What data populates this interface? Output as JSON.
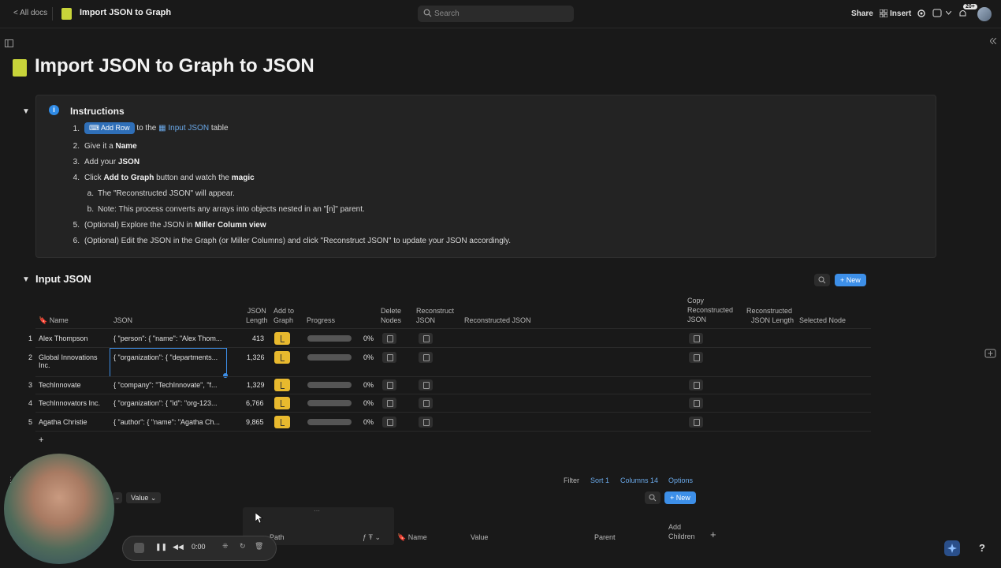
{
  "topbar": {
    "back": "< All docs",
    "title": "Import JSON to Graph",
    "search_placeholder": "Search",
    "share": "Share",
    "insert": "Insert",
    "notifications_badge": "20+"
  },
  "page": {
    "title": "Import JSON to Graph to JSON"
  },
  "instructions": {
    "title": "Instructions",
    "step1_button": "Add Row",
    "step1_mid": "to the",
    "step1_link": "Input JSON",
    "step1_end": "table",
    "step2_pre": "Give it a",
    "step2_bold": "Name",
    "step3_pre": "Add your",
    "step3_bold": "JSON",
    "step4_pre": "Click",
    "step4_bold": "Add to Graph",
    "step4_mid": "button and watch the",
    "step4_bold2": "magic",
    "step4a": "The \"Reconstructed JSON\" will appear.",
    "step4b": "Note: This process converts any arrays into objects nested in an \"[n]\" parent.",
    "step5_pre": "(Optional) Explore the JSON in",
    "step5_bold": "Miller Column view",
    "step6": "(Optional) Edit the JSON in the Graph (or Miller Columns) and click \"Reconstruct JSON\" to update your JSON accordingly.",
    "numbers": [
      "1.",
      "2.",
      "3.",
      "4.",
      "a.",
      "b.",
      "5.",
      "6."
    ]
  },
  "table": {
    "title": "Input JSON",
    "new_button": "New",
    "headers": {
      "name": "Name",
      "json": "JSON",
      "json_length_1": "JSON",
      "json_length_2": "Length",
      "add_graph_1": "Add to",
      "add_graph_2": "Graph",
      "progress": "Progress",
      "delete_1": "Delete",
      "delete_2": "Nodes",
      "reconstruct_1": "Reconstruct",
      "reconstruct_2": "JSON",
      "reconstructed": "Reconstructed JSON",
      "copy_1": "Copy",
      "copy_2": "Reconstructed",
      "copy_3": "JSON",
      "rlen_1": "Reconstructed",
      "rlen_2": "JSON Length",
      "selected": "Selected Node"
    },
    "rows": [
      {
        "num": "1",
        "name": "Alex Thompson",
        "name2": "",
        "json": "{ \"person\": { \"name\": \"Alex Thom...",
        "length": "413",
        "progress": "0%"
      },
      {
        "num": "2",
        "name": "Global Innovations",
        "name2": "Inc.",
        "json": "{ \"organization\": { \"departments...",
        "length": "1,326",
        "progress": "0%"
      },
      {
        "num": "3",
        "name": "TechInnovate",
        "name2": "",
        "json": "{ \"company\": \"TechInnovate\", \"f...",
        "length": "1,329",
        "progress": "0%"
      },
      {
        "num": "4",
        "name": "TechInnovators Inc.",
        "name2": "",
        "json": "{ \"organization\": { \"id\": \"org-123...",
        "length": "6,766",
        "progress": "0%"
      },
      {
        "num": "5",
        "name": "Agatha Christie",
        "name2": "",
        "json": "{ \"author\": { \"name\": \"Agatha Ch...",
        "length": "9,865",
        "progress": "0%"
      }
    ],
    "add_row": "+"
  },
  "second_table": {
    "filter": "Filter",
    "sort": "Sort 1",
    "columns": "Columns 14",
    "options": "Options",
    "value_chip": "Value",
    "new_button": "New",
    "headers": {
      "path": "Path",
      "name": "Name",
      "value": "Value",
      "parent": "Parent",
      "add_children_1": "Add",
      "add_children_2": "Children",
      "add": "+"
    }
  },
  "recorder": {
    "time": "0:00"
  },
  "help": "?",
  "colors": {
    "accent": "#3d8fe8",
    "yellow": "#e8b92e",
    "background": "#191919"
  }
}
